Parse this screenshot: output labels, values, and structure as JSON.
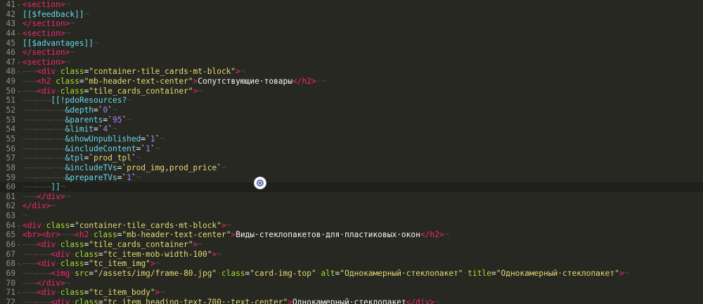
{
  "editor": {
    "current_line": 60,
    "lines": [
      {
        "n": "41",
        "fold": "-",
        "tokens": [
          [
            "tag",
            "<section>"
          ],
          [
            "ws",
            "¬"
          ]
        ]
      },
      {
        "n": "42",
        "fold": "",
        "tokens": [
          [
            "modx",
            "[[$feedback]]"
          ],
          [
            "ws",
            "¬"
          ]
        ]
      },
      {
        "n": "43",
        "fold": "",
        "tokens": [
          [
            "tag",
            "</section>"
          ],
          [
            "ws",
            "¬"
          ]
        ]
      },
      {
        "n": "44",
        "fold": "-",
        "tokens": [
          [
            "tag",
            "<section>"
          ],
          [
            "ws",
            "¬"
          ]
        ]
      },
      {
        "n": "45",
        "fold": "",
        "tokens": [
          [
            "modx",
            "[[$advantages]]"
          ],
          [
            "ws",
            "¬"
          ]
        ]
      },
      {
        "n": "46",
        "fold": "",
        "tokens": [
          [
            "tag",
            "</section>"
          ],
          [
            "ws",
            "¬"
          ]
        ]
      },
      {
        "n": "47",
        "fold": "-",
        "tokens": [
          [
            "tag",
            "<section>"
          ],
          [
            "ws",
            "¬"
          ]
        ]
      },
      {
        "n": "48",
        "fold": "-",
        "tokens": [
          [
            "ws",
            "——→"
          ],
          [
            "tag",
            "<div"
          ],
          [
            "ws",
            "·"
          ],
          [
            "attr",
            "class"
          ],
          [
            "text",
            "="
          ],
          [
            "str",
            "\"container·tile_cards·mt-block\""
          ],
          [
            "tag",
            ">"
          ],
          [
            "ws",
            "¬"
          ]
        ]
      },
      {
        "n": "49",
        "fold": "",
        "tokens": [
          [
            "ws",
            "——→"
          ],
          [
            "tag",
            "<h2"
          ],
          [
            "ws",
            "·"
          ],
          [
            "attr",
            "class"
          ],
          [
            "text",
            "="
          ],
          [
            "str",
            "\"mb-header·text-center\""
          ],
          [
            "tag",
            ">"
          ],
          [
            "text",
            "Сопутствующие·товары"
          ],
          [
            "tag",
            "</h2>"
          ],
          [
            "ws",
            "·¬"
          ]
        ]
      },
      {
        "n": "50",
        "fold": "-",
        "tokens": [
          [
            "ws",
            "——→"
          ],
          [
            "tag",
            "<div"
          ],
          [
            "ws",
            "·"
          ],
          [
            "attr",
            "class"
          ],
          [
            "text",
            "="
          ],
          [
            "str",
            "\"tile_cards_container\""
          ],
          [
            "tag",
            ">"
          ],
          [
            "ws",
            "¬"
          ]
        ]
      },
      {
        "n": "51",
        "fold": "",
        "tokens": [
          [
            "ws",
            "——→——→"
          ],
          [
            "modx",
            "[[!pdoResources?"
          ],
          [
            "ws",
            "¬"
          ]
        ]
      },
      {
        "n": "52",
        "fold": "",
        "tokens": [
          [
            "ws",
            "——→——→——→"
          ],
          [
            "modx",
            "&depth"
          ],
          [
            "text",
            "=`"
          ],
          [
            "num",
            "0"
          ],
          [
            "text",
            "`"
          ],
          [
            "ws",
            "¬"
          ]
        ]
      },
      {
        "n": "53",
        "fold": "",
        "tokens": [
          [
            "ws",
            "——→——→——→"
          ],
          [
            "modx",
            "&parents"
          ],
          [
            "text",
            "=`"
          ],
          [
            "num",
            "95"
          ],
          [
            "text",
            "`"
          ],
          [
            "ws",
            "¬"
          ]
        ]
      },
      {
        "n": "54",
        "fold": "",
        "tokens": [
          [
            "ws",
            "——→——→——→"
          ],
          [
            "modx",
            "&limit"
          ],
          [
            "text",
            "=`"
          ],
          [
            "num",
            "4"
          ],
          [
            "text",
            "`"
          ],
          [
            "ws",
            "¬"
          ]
        ]
      },
      {
        "n": "55",
        "fold": "",
        "tokens": [
          [
            "ws",
            "——→——→——→"
          ],
          [
            "modx",
            "&showUnpublished"
          ],
          [
            "text",
            "=`"
          ],
          [
            "num",
            "1"
          ],
          [
            "text",
            "`"
          ],
          [
            "ws",
            "¬"
          ]
        ]
      },
      {
        "n": "56",
        "fold": "",
        "tokens": [
          [
            "ws",
            "——→——→——→"
          ],
          [
            "modx",
            "&includeContent"
          ],
          [
            "text",
            "=`"
          ],
          [
            "num",
            "1"
          ],
          [
            "text",
            "`"
          ],
          [
            "ws",
            "¬"
          ]
        ]
      },
      {
        "n": "57",
        "fold": "",
        "tokens": [
          [
            "ws",
            "——→——→——→"
          ],
          [
            "modx",
            "&tpl"
          ],
          [
            "text",
            "=`"
          ],
          [
            "str",
            "prod_tpl"
          ],
          [
            "text",
            "`"
          ],
          [
            "ws",
            "¬"
          ]
        ]
      },
      {
        "n": "58",
        "fold": "",
        "tokens": [
          [
            "ws",
            "——→——→——→"
          ],
          [
            "modx",
            "&includeTVs"
          ],
          [
            "text",
            "=`"
          ],
          [
            "str",
            "prod_img,prod_price"
          ],
          [
            "text",
            "`"
          ],
          [
            "ws",
            "¬"
          ]
        ]
      },
      {
        "n": "59",
        "fold": "",
        "tokens": [
          [
            "ws",
            "——→——→——→"
          ],
          [
            "modx",
            "&prepareTVs"
          ],
          [
            "text",
            "=`"
          ],
          [
            "num",
            "1"
          ],
          [
            "text",
            "`"
          ],
          [
            "ws",
            "¬"
          ]
        ]
      },
      {
        "n": "60",
        "fold": "",
        "tokens": [
          [
            "ws",
            "——→——→"
          ],
          [
            "modx",
            "]]"
          ],
          [
            "ws",
            "¬"
          ]
        ]
      },
      {
        "n": "61",
        "fold": "",
        "tokens": [
          [
            "ws",
            "——→"
          ],
          [
            "tag",
            "</div>"
          ],
          [
            "ws",
            "¬"
          ]
        ]
      },
      {
        "n": "62",
        "fold": "",
        "tokens": [
          [
            "tag",
            "</div>"
          ],
          [
            "ws",
            "¬"
          ]
        ]
      },
      {
        "n": "63",
        "fold": "",
        "tokens": [
          [
            "ws",
            "¬"
          ]
        ]
      },
      {
        "n": "64",
        "fold": "-",
        "tokens": [
          [
            "tag",
            "<div"
          ],
          [
            "ws",
            "·"
          ],
          [
            "attr",
            "class"
          ],
          [
            "text",
            "="
          ],
          [
            "str",
            "\"container·tile_cards·mt-block\""
          ],
          [
            "tag",
            ">"
          ],
          [
            "ws",
            "¬"
          ]
        ]
      },
      {
        "n": "65",
        "fold": "",
        "tokens": [
          [
            "tag",
            "<br><br>"
          ],
          [
            "ws",
            "——→"
          ],
          [
            "tag",
            "<h2"
          ],
          [
            "ws",
            "·"
          ],
          [
            "attr",
            "class"
          ],
          [
            "text",
            "="
          ],
          [
            "str",
            "\"mb-header·text-center\""
          ],
          [
            "tag",
            ">"
          ],
          [
            "text",
            "Виды·стеклопакетов·для·пластиковых·окон"
          ],
          [
            "tag",
            "</h2>"
          ],
          [
            "ws",
            "¬"
          ]
        ]
      },
      {
        "n": "66",
        "fold": "-",
        "tokens": [
          [
            "ws",
            "——→"
          ],
          [
            "tag",
            "<div"
          ],
          [
            "ws",
            "·"
          ],
          [
            "attr",
            "class"
          ],
          [
            "text",
            "="
          ],
          [
            "str",
            "\"tile_cards_container\""
          ],
          [
            "tag",
            ">"
          ],
          [
            "ws",
            "¬"
          ]
        ]
      },
      {
        "n": "67",
        "fold": "",
        "tokens": [
          [
            "ws",
            "——→——→"
          ],
          [
            "tag",
            "<div"
          ],
          [
            "ws",
            "·"
          ],
          [
            "attr",
            "class"
          ],
          [
            "text",
            "="
          ],
          [
            "str",
            "\"tc_item·mob-width-100\""
          ],
          [
            "tag",
            ">"
          ],
          [
            "ws",
            "¬"
          ]
        ]
      },
      {
        "n": "68",
        "fold": "-",
        "tokens": [
          [
            "ws",
            "——→"
          ],
          [
            "tag",
            "<div"
          ],
          [
            "ws",
            "·"
          ],
          [
            "attr",
            "class"
          ],
          [
            "text",
            "="
          ],
          [
            "str",
            "\"tc_item_img\""
          ],
          [
            "tag",
            ">"
          ],
          [
            "ws",
            "¬"
          ]
        ]
      },
      {
        "n": "69",
        "fold": "",
        "tokens": [
          [
            "ws",
            "——→——→"
          ],
          [
            "tag",
            "<img"
          ],
          [
            "ws",
            "·"
          ],
          [
            "attr",
            "src"
          ],
          [
            "text",
            "="
          ],
          [
            "str",
            "\"/assets/img/frame-80.jpg\""
          ],
          [
            "ws",
            "·"
          ],
          [
            "attr",
            "class"
          ],
          [
            "text",
            "="
          ],
          [
            "str",
            "\"card-img-top\""
          ],
          [
            "ws",
            "·"
          ],
          [
            "attr",
            "alt"
          ],
          [
            "text",
            "="
          ],
          [
            "str",
            "\"Однокамерный·стеклопакет\""
          ],
          [
            "ws",
            "·"
          ],
          [
            "attr",
            "title"
          ],
          [
            "text",
            "="
          ],
          [
            "str",
            "\"Однокамерный·стеклопакет\""
          ],
          [
            "tag",
            ">"
          ],
          [
            "ws",
            "¬"
          ]
        ]
      },
      {
        "n": "70",
        "fold": "",
        "tokens": [
          [
            "ws",
            "——→"
          ],
          [
            "tag",
            "</div>"
          ],
          [
            "ws",
            "¬"
          ]
        ]
      },
      {
        "n": "71",
        "fold": "-",
        "tokens": [
          [
            "ws",
            "——→"
          ],
          [
            "tag",
            "<div"
          ],
          [
            "ws",
            "·"
          ],
          [
            "attr",
            "class"
          ],
          [
            "text",
            "="
          ],
          [
            "str",
            "\"tc_item_body\""
          ],
          [
            "tag",
            ">"
          ],
          [
            "ws",
            "¬"
          ]
        ]
      },
      {
        "n": "72",
        "fold": "",
        "tokens": [
          [
            "ws",
            "——→——→"
          ],
          [
            "tag",
            "<div"
          ],
          [
            "ws",
            "·"
          ],
          [
            "attr",
            "class"
          ],
          [
            "text",
            "="
          ],
          [
            "str",
            "\"tc_item_heading·text-700··text-center\""
          ],
          [
            "tag",
            ">"
          ],
          [
            "text",
            "Однокамерный·стеклопакет"
          ],
          [
            "tag",
            "</div>"
          ],
          [
            "ws",
            "¬"
          ]
        ]
      }
    ]
  }
}
